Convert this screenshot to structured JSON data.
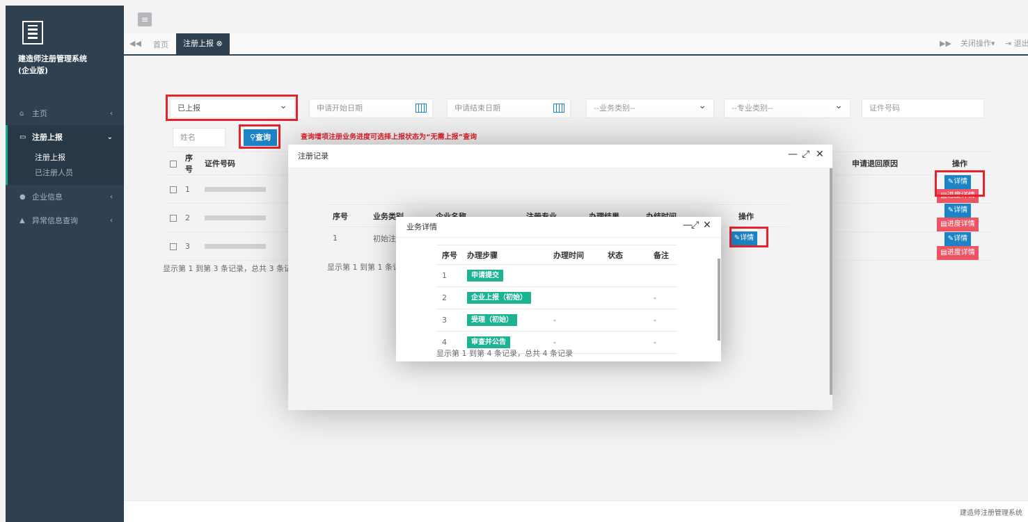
{
  "sidebar": {
    "app_title_line1": "建造师注册管理系统",
    "app_title_line2": "(企业版)",
    "menu": [
      {
        "label": "主页",
        "icon": "home-icon"
      },
      {
        "label": "注册上报",
        "icon": "monitor-icon"
      },
      {
        "label": "企业信息",
        "icon": "user-icon"
      },
      {
        "label": "异常信息查询",
        "icon": "warning-icon"
      }
    ],
    "submenu": [
      "注册上报",
      "已注册人员"
    ]
  },
  "tabs": {
    "home": "首页",
    "active": "注册上报",
    "close_ops": "关闭操作",
    "logout": "退出"
  },
  "filters": {
    "status_selected": "已上报",
    "start_date_placeholder": "申请开始日期",
    "end_date_placeholder": "申请结束日期",
    "biz_type_selected": "--业务类别--",
    "major_type_selected": "--专业类别--",
    "cert_no_placeholder": "证件号码",
    "name_placeholder": "姓名",
    "query_button": "查询",
    "hint": "查询增项注册业务进度可选择上报状态为“无需上报”查询"
  },
  "main_table": {
    "headers": [
      "序号",
      "证件号码"
    ],
    "right_headers": {
      "reject_reason": "申请退回原因",
      "ops": "操作"
    },
    "rows": [
      {
        "no": "1"
      },
      {
        "no": "2"
      },
      {
        "no": "3"
      }
    ],
    "detail_button": "详情",
    "progress_button": "进度详情",
    "pager": "显示第 1 到第 3 条记录，总共 3 条记录"
  },
  "modal_record": {
    "title": "注册记录",
    "headers": [
      "序号",
      "业务类别",
      "企业名称",
      "注册专业",
      "办理结果",
      "办结时间",
      "操作"
    ],
    "row": {
      "no": "1",
      "biz_type": "初始注册"
    },
    "detail_button": "详情",
    "pager": "显示第 1 到第 1 条记录"
  },
  "modal_detail": {
    "title": "业务详情",
    "headers": [
      "序号",
      "办理步骤",
      "办理时间",
      "状态",
      "备注"
    ],
    "rows": [
      {
        "no": "1",
        "step": "申请提交",
        "time": "",
        "status": "",
        "note": ""
      },
      {
        "no": "2",
        "step": "企业上报（初始）",
        "time": "",
        "status": "",
        "note": "-"
      },
      {
        "no": "3",
        "step": "受理（初始）",
        "time": "-",
        "status": "",
        "note": "-"
      },
      {
        "no": "4",
        "step": "审查并公告",
        "time": "-",
        "status": "",
        "note": "-"
      }
    ],
    "pager": "显示第 1 到第 4 条记录，总共 4 条记录"
  },
  "footer": "建造师注册管理系统"
}
